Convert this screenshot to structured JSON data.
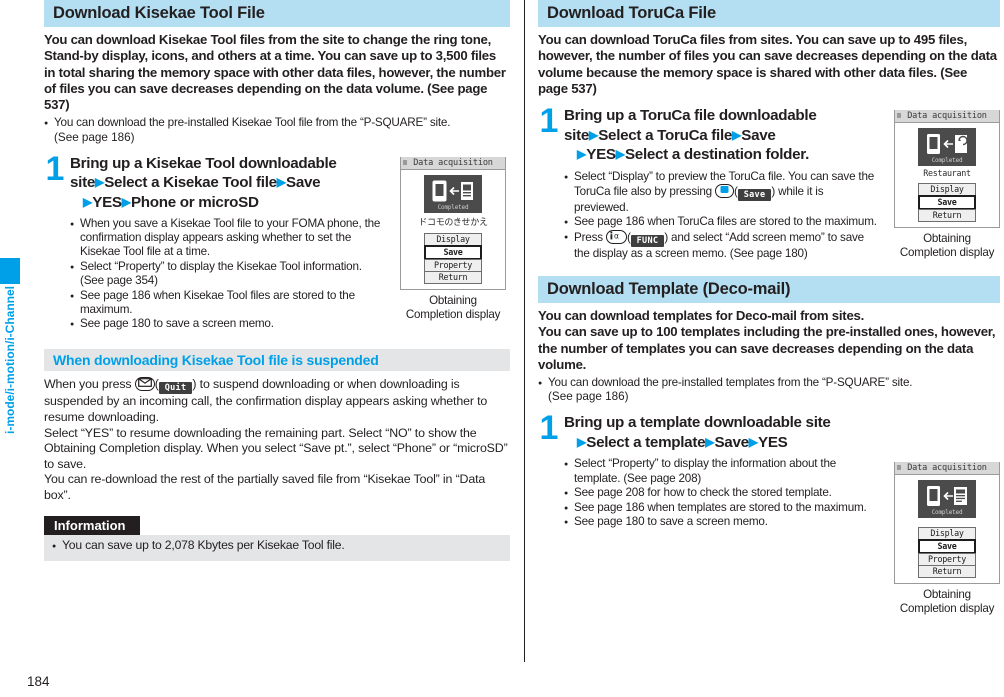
{
  "page_number": "184",
  "side_tab": {
    "label": "i-mode/i-motion/i-Channel",
    "color": "#00a0e9"
  },
  "colors": {
    "section_header_bg": "#b4dff2",
    "sub_header_bg": "#e4e5e6",
    "accent": "#00a0e9",
    "info_header_bg": "#231f20"
  },
  "left": {
    "section": {
      "title": "Download Kisekae Tool File"
    },
    "lead": "You can download Kisekae Tool files from the site to change the ring tone, Stand-by display, icons, and others at a time. You can save up to 3,500 files in total sharing the memory space with other data files, however, the number of files you can save decreases depending on the data volume. (See page 537)",
    "lead_bullets": [
      "You can download the pre-installed Kisekae Tool file from the “P-SQUARE” site."
    ],
    "lead_bullet_cont": "(See page 186)",
    "step": {
      "number": "1",
      "title_line1_a": "Bring up a Kisekae Tool downloadable",
      "title_line2_a": "site",
      "title_line2_b": "Select a Kisekae Tool file",
      "title_line2_c": "Save",
      "title_line3_a": "YES",
      "title_line3_b": "Phone or microSD",
      "bullets": [
        "When you save a Kisekae Tool file to your FOMA phone, the confirmation display appears asking whether to set the Kisekae Tool file at a time.",
        "Select “Property” to display the Kisekae Tool information. (See page 354)",
        "See page 186 when Kisekae Tool files are stored to the maximum.",
        "See page 180 to save a screen memo."
      ]
    },
    "phone": {
      "title": "Data acquisition",
      "icon_label": "Completed",
      "caption": "ドコモのきせかえ",
      "menu": [
        "Display",
        "Save",
        "Property",
        "Return"
      ],
      "selected_menu": "Save",
      "fig_caption_line1": "Obtaining",
      "fig_caption_line2": "Completion display"
    },
    "sub_section": {
      "title": "When downloading Kisekae Tool file is suspended",
      "para1_a": "When you press ",
      "para1_key": "mail-key-icon",
      "para1_softkey": "Quit",
      "para1_b": ") to suspend downloading or when downloading is suspended by an incoming call, the confirmation display appears asking whether to resume downloading.",
      "para2": "Select “YES” to resume downloading the remaining part. Select “NO” to show the Obtaining Completion display. When you select “Save pt.”, select “Phone” or “microSD” to save.",
      "para3": "You can re-download the rest of the partially saved file from “Kisekae Tool” in “Data box”."
    },
    "information": {
      "header": "Information",
      "items": [
        "You can save up to 2,078 Kbytes per Kisekae Tool file."
      ]
    }
  },
  "right": {
    "section_toruca": {
      "title": "Download ToruCa File"
    },
    "toruca_lead": "You can download ToruCa files from sites. You can save up to 495 files, however, the number of files you can save decreases depending on the data volume because the memory space is shared with other data files. (See page 537)",
    "toruca_step": {
      "number": "1",
      "title_line1_a": "Bring up a ToruCa file downloadable",
      "title_line2_a": "site",
      "title_line2_b": "Select a ToruCa file",
      "title_line2_c": "Save",
      "title_line3_a": "YES",
      "title_line3_b": "Select a destination folder.",
      "bullet1_a": "Select “Display” to preview the ToruCa file. You can save the ToruCa file also by pressing ",
      "bullet1_key": "center-key-icon",
      "bullet1_softkey": "Save",
      "bullet1_b": ") while it is previewed.",
      "bullet2": "See page 186 when ToruCa files are stored to the maximum.",
      "bullet3_a": "Press ",
      "bullet3_key": "imode-key-icon",
      "bullet3_softkey": "FUNC",
      "bullet3_b": ") and select “Add screen memo” to save the display as a screen memo. (See page 180)"
    },
    "toruca_phone": {
      "title": "Data acquisition",
      "icon_label": "Completed",
      "caption": "Restaurant",
      "menu": [
        "Display",
        "Save",
        "Return"
      ],
      "selected_menu": "Save",
      "fig_caption_line1": "Obtaining",
      "fig_caption_line2": "Completion display"
    },
    "section_template": {
      "title": "Download Template (Deco-mail)"
    },
    "template_lead_line1": "You can download templates for Deco-mail from sites.",
    "template_lead_line2": "You can save up to 100 templates including the pre-installed ones, however, the number of templates you can save decreases depending on the data volume.",
    "template_lead_bullets": [
      "You can download the pre-installed templates from the “P-SQUARE” site."
    ],
    "template_lead_bullet_cont": "(See page 186)",
    "template_step": {
      "number": "1",
      "title_line1_a": "Bring up a template downloadable site",
      "title_line2_a": "Select a template",
      "title_line2_b": "Save",
      "title_line2_c": "YES",
      "bullets": [
        "Select “Property” to display the information about the template. (See page 208)",
        "See page 208 for how to check the stored template.",
        "See page 186 when templates are stored to the maximum.",
        "See page 180 to save a screen memo."
      ]
    },
    "template_phone": {
      "title": "Data acquisition",
      "icon_label": "Completed",
      "menu": [
        "Display",
        "Save",
        "Property",
        "Return"
      ],
      "selected_menu": "Save",
      "fig_caption_line1": "Obtaining",
      "fig_caption_line2": "Completion display"
    }
  }
}
